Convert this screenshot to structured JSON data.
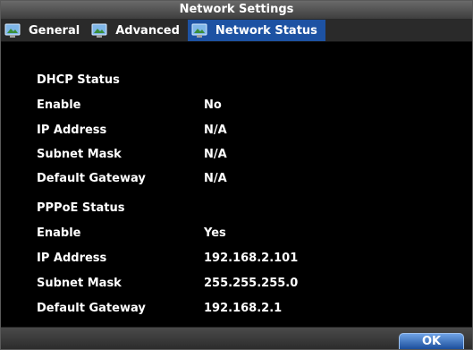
{
  "window": {
    "title": "Network Settings"
  },
  "tabs": [
    {
      "label": "General",
      "icon": "monitor-icon",
      "active": false
    },
    {
      "label": "Advanced",
      "icon": "monitor-icon",
      "active": false
    },
    {
      "label": "Network Status",
      "icon": "monitor-icon",
      "active": true
    }
  ],
  "dhcp": {
    "heading": "DHCP Status",
    "rows": [
      {
        "label": "Enable",
        "value": "No"
      },
      {
        "label": "IP Address",
        "value": "N/A"
      },
      {
        "label": "Subnet Mask",
        "value": "N/A"
      },
      {
        "label": "Default Gateway",
        "value": "N/A"
      }
    ]
  },
  "pppoe": {
    "heading": "PPPoE Status",
    "rows": [
      {
        "label": "Enable",
        "value": "Yes"
      },
      {
        "label": "IP Address",
        "value": "192.168.2.101"
      },
      {
        "label": "Subnet Mask",
        "value": "255.255.255.0"
      },
      {
        "label": "Default Gateway",
        "value": "192.168.2.1"
      }
    ]
  },
  "footer": {
    "ok_label": "OK"
  },
  "colors": {
    "active_tab": "#1d52a3",
    "background": "#000000",
    "text": "#ffffff",
    "ok_button": "#3f7bcc"
  }
}
